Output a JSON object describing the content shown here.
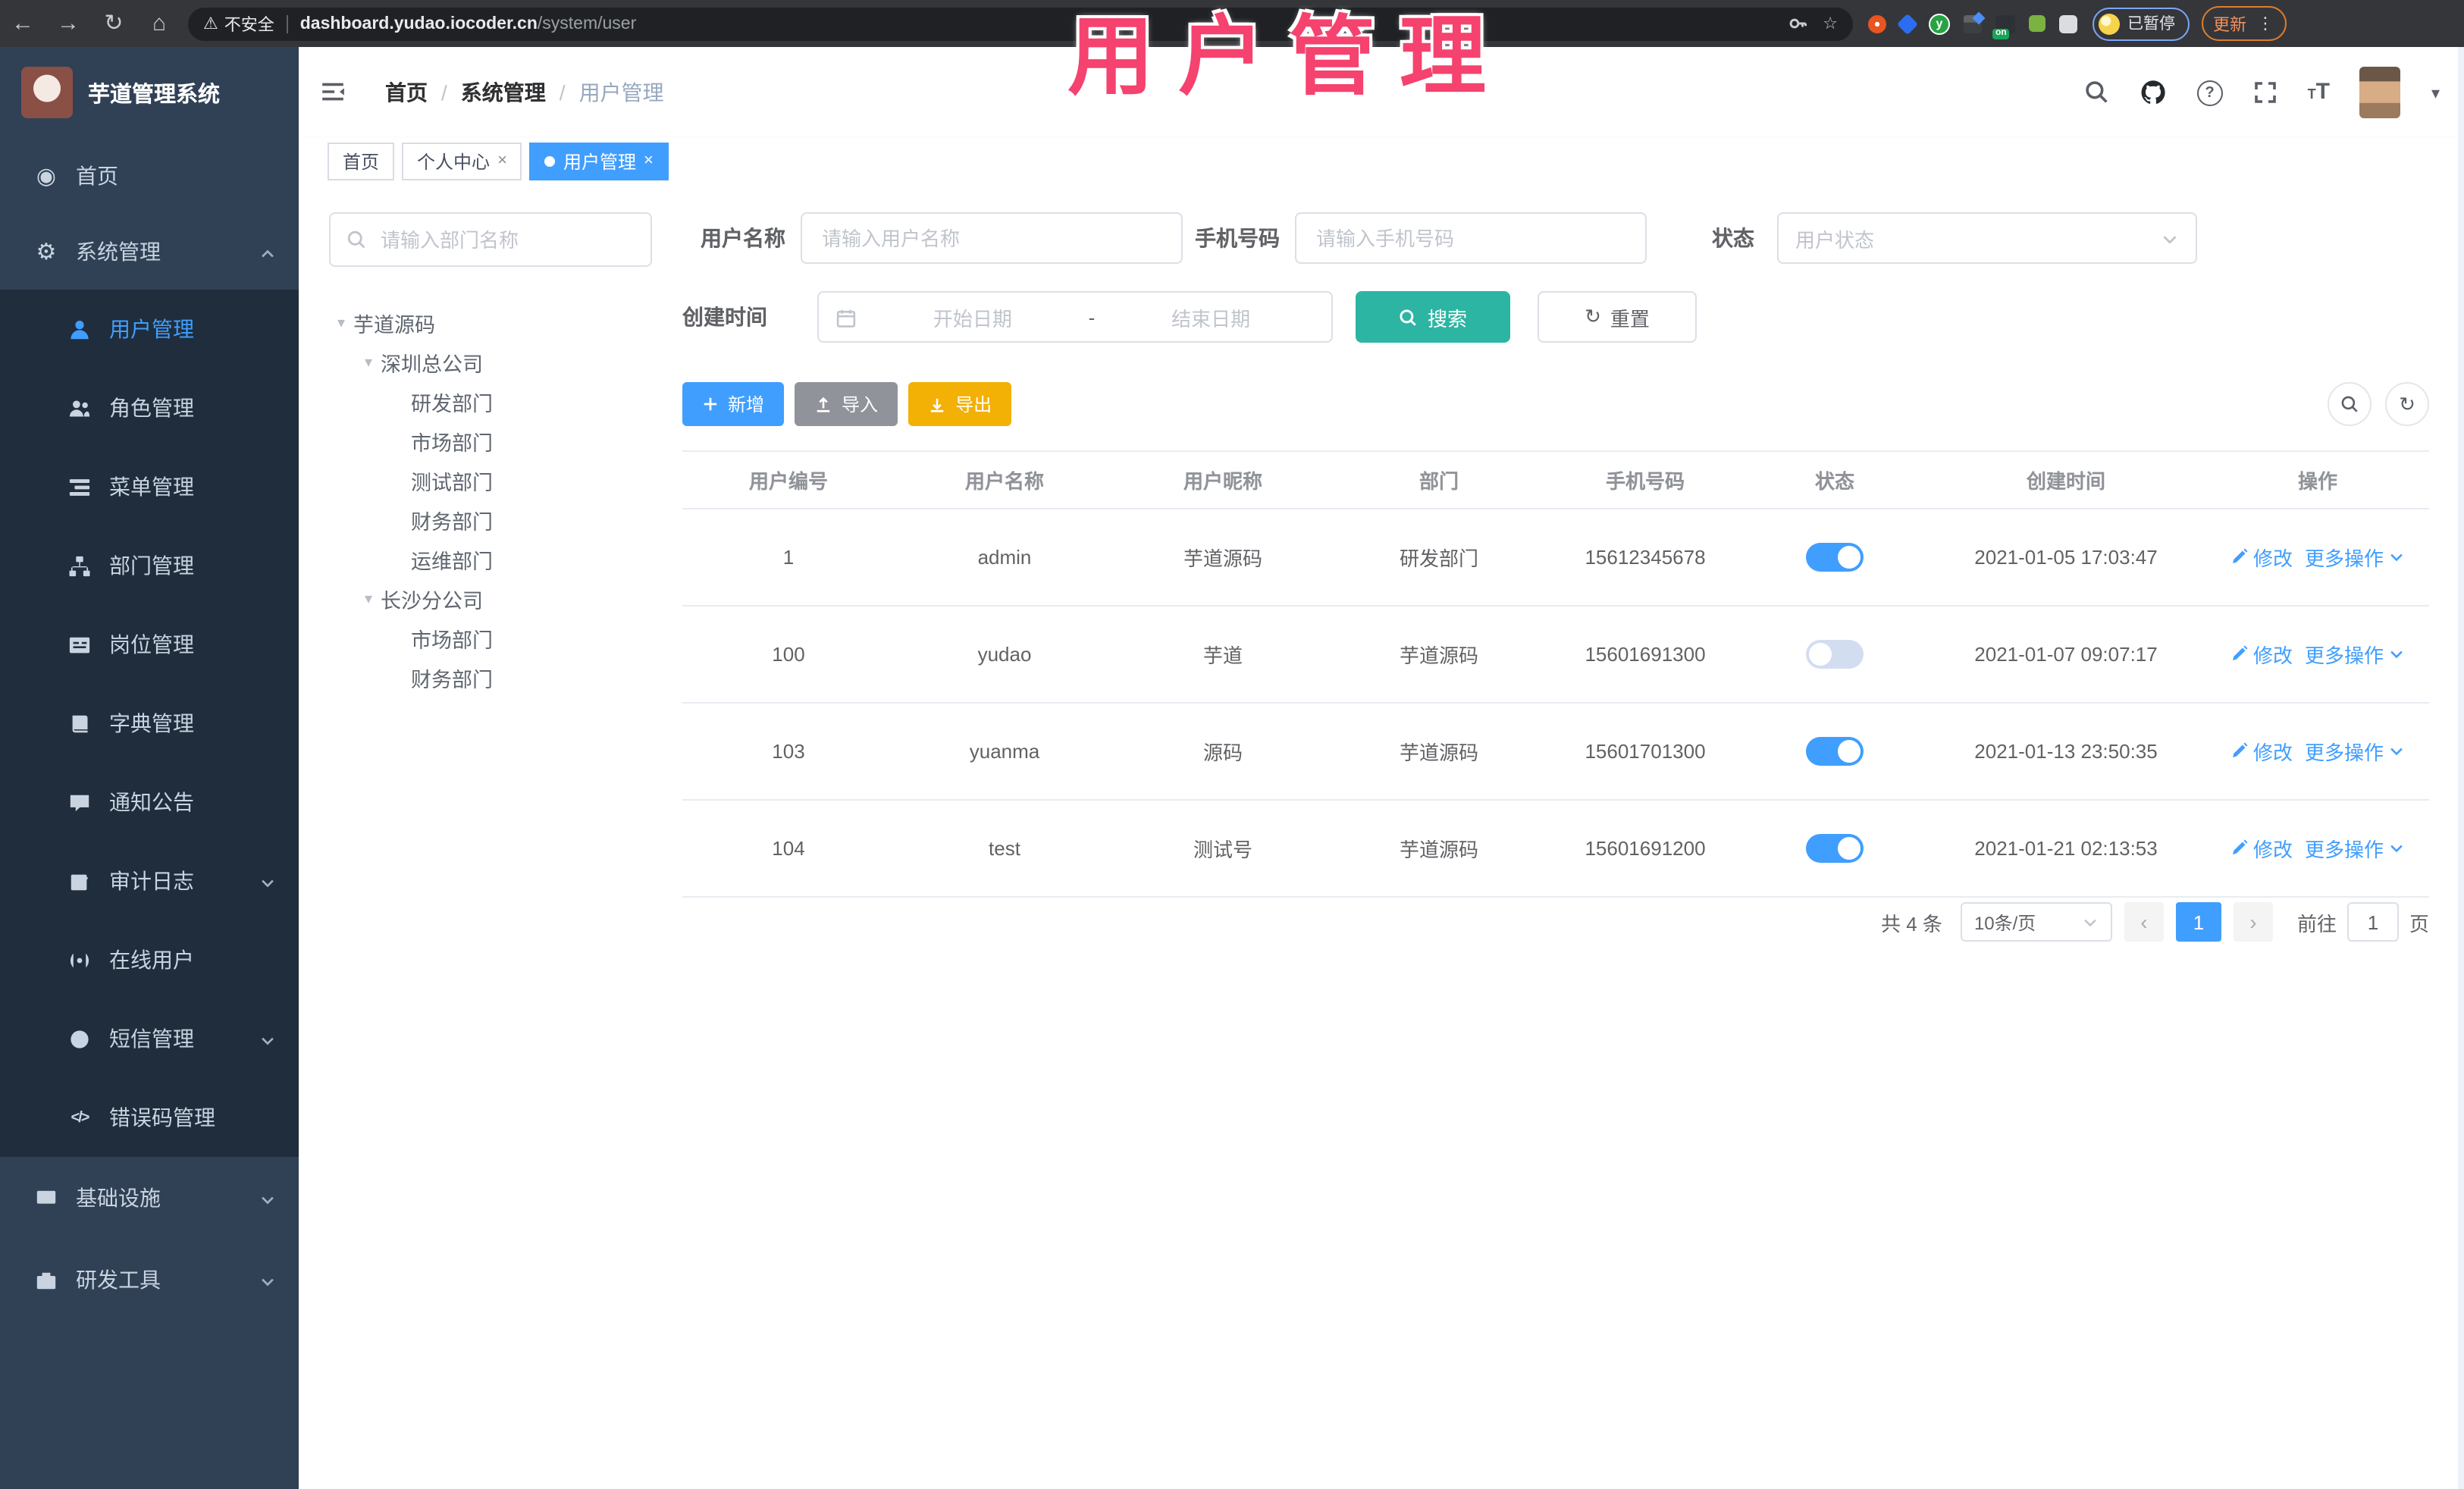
{
  "browser": {
    "warning": "不安全",
    "url_host": "dashboard.yudao.iocoder.cn",
    "url_path": "/system/user",
    "extension_badge": "on",
    "extension_letter": "y",
    "paused_badge": "已暂停",
    "update_button": "更新"
  },
  "annotation": {
    "text": "用户管理",
    "color": "#f5426e"
  },
  "sidebar": {
    "title": "芋道管理系统",
    "items": [
      {
        "label": "首页"
      },
      {
        "label": "系统管理"
      },
      {
        "label": "用户管理"
      },
      {
        "label": "角色管理"
      },
      {
        "label": "菜单管理"
      },
      {
        "label": "部门管理"
      },
      {
        "label": "岗位管理"
      },
      {
        "label": "字典管理"
      },
      {
        "label": "通知公告"
      },
      {
        "label": "审计日志"
      },
      {
        "label": "在线用户"
      },
      {
        "label": "短信管理"
      },
      {
        "label": "错误码管理"
      },
      {
        "label": "基础设施"
      },
      {
        "label": "研发工具"
      }
    ]
  },
  "breadcrumb": {
    "items": [
      "首页",
      "系统管理",
      "用户管理"
    ],
    "separator": "/"
  },
  "tabs": [
    {
      "label": "首页"
    },
    {
      "label": "个人中心"
    },
    {
      "label": "用户管理"
    }
  ],
  "dept_panel": {
    "search_placeholder": "请输入部门名称",
    "nodes": [
      {
        "label": "芋道源码"
      },
      {
        "label": "深圳总公司"
      },
      {
        "label": "研发部门"
      },
      {
        "label": "市场部门"
      },
      {
        "label": "测试部门"
      },
      {
        "label": "财务部门"
      },
      {
        "label": "运维部门"
      },
      {
        "label": "长沙分公司"
      },
      {
        "label": "市场部门"
      },
      {
        "label": "财务部门"
      }
    ]
  },
  "filters": {
    "username_label": "用户名称",
    "username_placeholder": "请输入用户名称",
    "mobile_label": "手机号码",
    "mobile_placeholder": "请输入手机号码",
    "status_label": "状态",
    "status_placeholder": "用户状态",
    "time_label": "创建时间",
    "start_placeholder": "开始日期",
    "range_separator": "-",
    "end_placeholder": "结束日期",
    "search_label": "搜索",
    "reset_label": "重置"
  },
  "toolbar": {
    "add_label": "新增",
    "import_label": "导入",
    "export_label": "导出"
  },
  "table": {
    "columns": [
      "用户编号",
      "用户名称",
      "用户昵称",
      "部门",
      "手机号码",
      "状态",
      "创建时间",
      "操作"
    ],
    "edit_label": "修改",
    "more_label": "更多操作",
    "rows": [
      {
        "id": "1",
        "username": "admin",
        "nickname": "芋道源码",
        "dept": "研发部门",
        "mobile": "15612345678",
        "status": "on",
        "created": "2021-01-05 17:03:47"
      },
      {
        "id": "100",
        "username": "yudao",
        "nickname": "芋道",
        "dept": "芋道源码",
        "mobile": "15601691300",
        "status": "off",
        "created": "2021-01-07 09:07:17"
      },
      {
        "id": "103",
        "username": "yuanma",
        "nickname": "源码",
        "dept": "芋道源码",
        "mobile": "15601701300",
        "status": "on",
        "created": "2021-01-13 23:50:35"
      },
      {
        "id": "104",
        "username": "test",
        "nickname": "测试号",
        "dept": "芋道源码",
        "mobile": "15601691200",
        "status": "on",
        "created": "2021-01-21 02:13:53"
      }
    ]
  },
  "pagination": {
    "total": "共 4 条",
    "page_size": "10条/页",
    "current_page": "1",
    "goto_label": "前往",
    "goto_value": "1",
    "unit_label": "页"
  },
  "icons": {
    "back": "←",
    "forward": "→",
    "reload": "↻",
    "home": "⌂",
    "warning": "⚠",
    "star": "☆",
    "kebab": "⋮",
    "gear": "⚙",
    "dashboard": "◉",
    "code": "</>",
    "caret_down": "▾",
    "caret_up": "▴",
    "close": "×",
    "question": "?",
    "t_big": "T",
    "t_small": "T",
    "prev": "‹",
    "next": "›",
    "refresh": "↻",
    "hdr_caret": "▾"
  },
  "accent_colors": {
    "primary": "#409eff",
    "search_teal": "#2cb5a2",
    "export_yellow": "#f3b005",
    "import_gray": "#909399",
    "sidebar_bg": "#304156",
    "submenu_bg": "#1f2d3d"
  }
}
